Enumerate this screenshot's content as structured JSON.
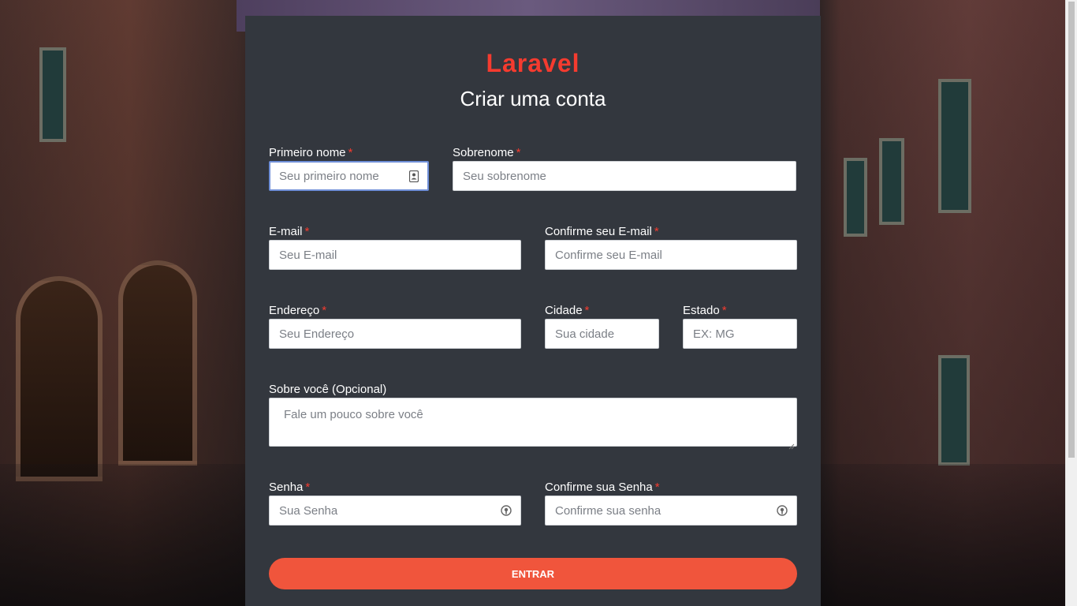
{
  "brand": {
    "logo_text": "Laravel",
    "accent_color": "#f53b2f"
  },
  "page_title": "Criar uma conta",
  "form": {
    "first_name": {
      "label": "Primeiro nome",
      "required_mark": "*",
      "placeholder": "Seu primeiro nome",
      "value": ""
    },
    "last_name": {
      "label": "Sobrenome",
      "required_mark": "*",
      "placeholder": "Seu sobrenome",
      "value": ""
    },
    "email": {
      "label": "E-mail",
      "required_mark": "*",
      "placeholder": "Seu E-mail",
      "value": ""
    },
    "email_confirm": {
      "label": "Confirme seu E-mail",
      "required_mark": "*",
      "placeholder": "Confirme seu E-mail",
      "value": ""
    },
    "address": {
      "label": "Endereço",
      "required_mark": "*",
      "placeholder": "Seu Endereço",
      "value": ""
    },
    "city": {
      "label": "Cidade",
      "required_mark": "*",
      "placeholder": "Sua cidade",
      "value": ""
    },
    "state": {
      "label": "Estado",
      "required_mark": "*",
      "placeholder": "EX: MG",
      "value": ""
    },
    "about": {
      "label": "Sobre você (Opcional)",
      "placeholder": "Fale um pouco sobre você",
      "value": ""
    },
    "password": {
      "label": "Senha",
      "required_mark": "*",
      "placeholder": "Sua Senha",
      "value": ""
    },
    "password_confirm": {
      "label": "Confirme sua Senha",
      "required_mark": "*",
      "placeholder": "Confirme sua senha",
      "value": ""
    },
    "submit_label": "ENTRAR",
    "button_color": "#f0553c"
  },
  "icons": {
    "first_name_field_icon": "contact-card-icon",
    "password_field_icon": "password-manager-icon",
    "password_confirm_field_icon": "password-manager-icon"
  }
}
